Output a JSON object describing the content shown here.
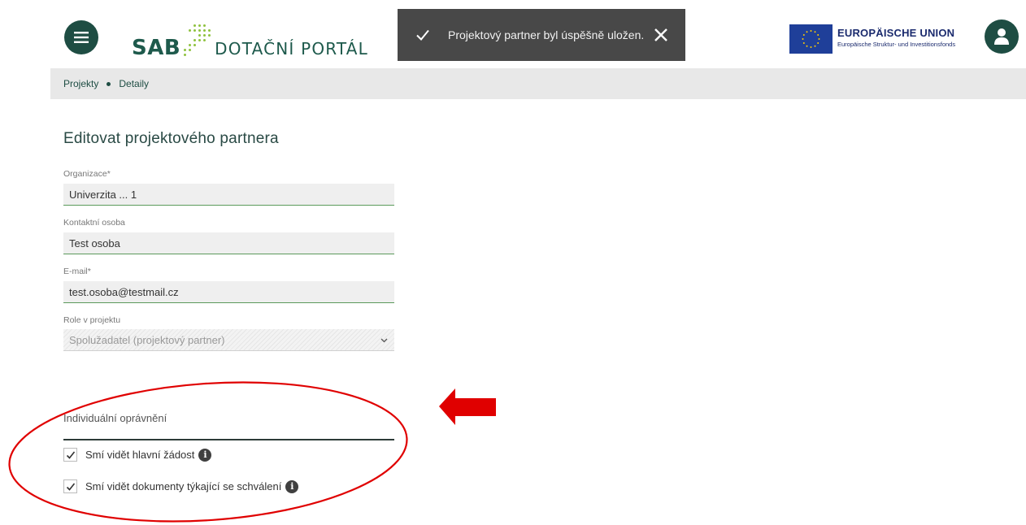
{
  "header": {
    "logo_brand": "SAB",
    "logo_portal": "DOTAČNÍ PORTÁL",
    "eu_title": "EUROPÄISCHE UNION",
    "eu_subtitle": "Europäische Struktur- und Investitionsfonds",
    "icons": {
      "menu": "hamburger-menu-icon",
      "user": "user-icon"
    }
  },
  "toast": {
    "message": "Projektový partner byl úspěšně uložen.",
    "icons": {
      "status": "checkmark-icon",
      "close": "close-icon"
    }
  },
  "breadcrumb": {
    "items": [
      "Projekty",
      "Detaily"
    ]
  },
  "form": {
    "title": "Editovat projektového partnera",
    "fields": [
      {
        "label": "Organizace*",
        "value": "Univerzita ... 1"
      },
      {
        "label": "Kontaktní osoba",
        "value": "Test osoba"
      },
      {
        "label": "E-mail*",
        "value": "test.osoba@testmail.cz"
      }
    ],
    "role": {
      "label": "Role v projektu",
      "value": "Spolužadatel (projektový partner)"
    },
    "permissions": {
      "title": "Individuální oprávnění",
      "items": [
        {
          "label": "Smí vidět hlavní žádost",
          "checked": true
        },
        {
          "label": "Smí vidět dokumenty týkající se schválení",
          "checked": true
        }
      ]
    }
  },
  "colors": {
    "brand_dark": "#1e4d43",
    "brand_green": "#8fc23f",
    "annotation": "#e00000",
    "toast_bg": "#484848"
  }
}
